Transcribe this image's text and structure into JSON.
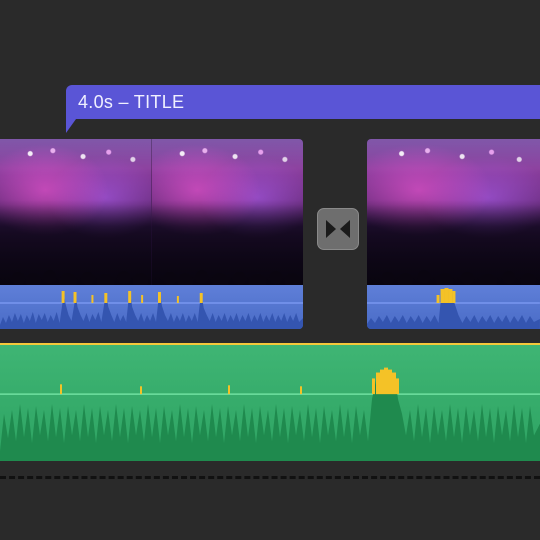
{
  "title_clip": {
    "label": "4.0s – TITLE"
  },
  "icons": {
    "transition": "crossfade"
  }
}
